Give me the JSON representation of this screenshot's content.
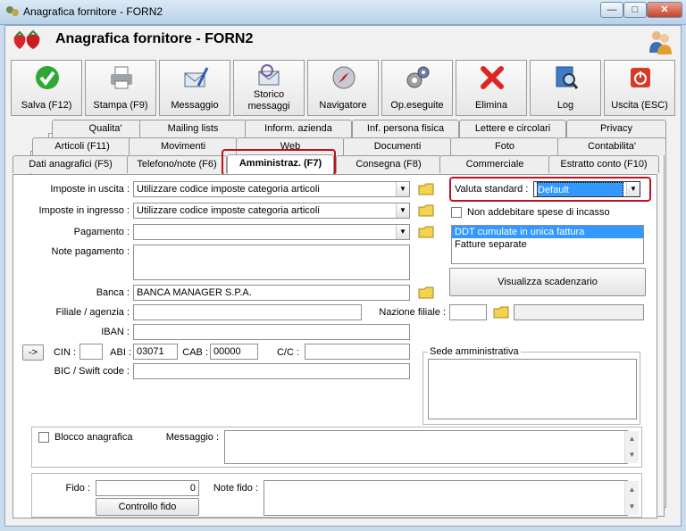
{
  "window": {
    "title": "Anagrafica fornitore - FORN2"
  },
  "header": {
    "title": "Anagrafica fornitore - FORN2"
  },
  "toolbar": [
    {
      "label": "Salva (F12)",
      "icon": "check-icon"
    },
    {
      "label": "Stampa (F9)",
      "icon": "printer-icon"
    },
    {
      "label": "Messaggio",
      "icon": "message-icon"
    },
    {
      "label": "Storico\nmessaggi",
      "icon": "message-history-icon"
    },
    {
      "label": "Navigatore",
      "icon": "compass-icon"
    },
    {
      "label": "Op.eseguite",
      "icon": "gears-icon"
    },
    {
      "label": "Elimina",
      "icon": "delete-icon"
    },
    {
      "label": "Log",
      "icon": "log-icon"
    },
    {
      "label": "Uscita (ESC)",
      "icon": "exit-icon"
    }
  ],
  "tabs": {
    "row1": [
      "Qualita'",
      "Mailing lists",
      "Inform. azienda",
      "Inf. persona fisica",
      "Lettere e circolari",
      "Privacy"
    ],
    "row2": [
      "Articoli (F11)",
      "Movimenti",
      "Web",
      "Documenti",
      "Foto",
      "Contabilita'"
    ],
    "row3": [
      "Dati anagrafici (F5)",
      "Telefono/note (F6)",
      "Amministraz. (F7)",
      "Consegna (F8)",
      "Commerciale",
      "Estratto conto (F10)"
    ],
    "active": "Amministraz. (F7)"
  },
  "form": {
    "imposte_uscita_label": "Imposte in uscita :",
    "imposte_uscita_value": "Utilizzare codice imposte categoria articoli",
    "imposte_ingresso_label": "Imposte in ingresso :",
    "imposte_ingresso_value": "Utilizzare codice imposte categoria articoli",
    "pagamento_label": "Pagamento :",
    "pagamento_value": "",
    "note_pagamento_label": "Note pagamento :",
    "note_pagamento_value": "",
    "banca_label": "Banca :",
    "banca_value": "BANCA MANAGER S.P.A.",
    "filiale_label": "Filiale / agenzia :",
    "filiale_value": "",
    "nazione_filiale_label": "Nazione filiale :",
    "nazione_filiale_value": "",
    "iban_label": "IBAN :",
    "iban_value": "",
    "arrow_button": "->",
    "cin_label": "CIN :",
    "cin_value": "",
    "abi_label": "ABI :",
    "abi_value": "03071",
    "cab_label": "CAB :",
    "cab_value": "00000",
    "cc_label": "C/C :",
    "cc_value": "",
    "bic_label": "BIC / Swift code :",
    "bic_value": "",
    "valuta_label": "Valuta standard :",
    "valuta_value": "Default",
    "non_addebitare_label": "Non addebitare spese di incasso",
    "fatturazione_options": [
      "DDT cumulate in unica fattura",
      "Fatture separate"
    ],
    "fatturazione_selected": "DDT cumulate in unica fattura",
    "visualizza_button": "Visualizza scadenzario",
    "sede_label": "Sede amministrativa",
    "sede_value": "",
    "blocco_label": "Blocco anagrafica",
    "messaggio_label": "Messaggio :",
    "messaggio_value": "",
    "fido_label": "Fido :",
    "fido_value": "0",
    "note_fido_label": "Note fido :",
    "note_fido_value": "",
    "controllo_fido_button": "Controllo fido"
  },
  "colors": {
    "selection": "#3399ff",
    "highlight_red": "#c0101f"
  }
}
